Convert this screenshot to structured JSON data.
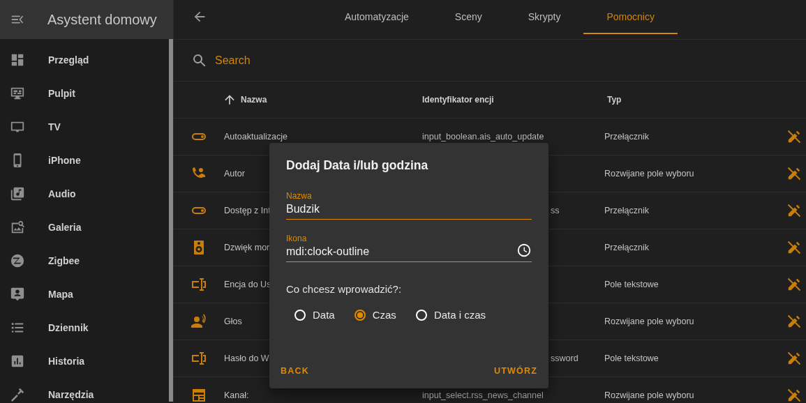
{
  "sidebar": {
    "title": "Asystent domowy",
    "items": [
      {
        "label": "Przegląd"
      },
      {
        "label": "Pulpit"
      },
      {
        "label": "TV"
      },
      {
        "label": "iPhone"
      },
      {
        "label": "Audio"
      },
      {
        "label": "Galeria"
      },
      {
        "label": "Zigbee"
      },
      {
        "label": "Mapa"
      },
      {
        "label": "Dziennik"
      },
      {
        "label": "Historia"
      },
      {
        "label": "Narzędzia"
      }
    ]
  },
  "tabs": [
    {
      "label": "Automatyzacje",
      "selected": false
    },
    {
      "label": "Sceny",
      "selected": false
    },
    {
      "label": "Skrypty",
      "selected": false
    },
    {
      "label": "Pomocnicy",
      "selected": true
    }
  ],
  "search": {
    "placeholder": "Search"
  },
  "table": {
    "columns": [
      "Nazwa",
      "Identyfikator encji",
      "Typ"
    ],
    "rows": [
      {
        "name": "Autoaktualizacje",
        "entity_id": "input_boolean.ais_auto_update",
        "type": "Przełącznik"
      },
      {
        "name": "Autor",
        "type": "Rozwijane pole wyboru"
      },
      {
        "name": "Dostęp z Int",
        "entity_id_tail": "ss",
        "type": "Przełącznik"
      },
      {
        "name": "Dzwięk mor",
        "type": "Przełącznik"
      },
      {
        "name": "Encja do Us",
        "type": "Pole tekstowe"
      },
      {
        "name": "Głos",
        "type": "Rozwijane pole wyboru"
      },
      {
        "name": "Hasło do W",
        "entity_id_tail": "ssword",
        "type": "Pole tekstowe"
      },
      {
        "name": "Kanał:",
        "entity_id": "input_select.rss_news_channel",
        "type": "Rozwijane pole wyboru"
      }
    ]
  },
  "dialog": {
    "title": "Dodaj Data i/lub godzina",
    "fields": [
      {
        "label": "Nazwa",
        "value": "Budzik",
        "kind": "text"
      },
      {
        "label": "Ikona",
        "value": "mdi:clock-outline",
        "kind": "icon"
      }
    ],
    "question": "Co chcesz wprowadzić?:",
    "options": [
      {
        "label": "Data",
        "selected": false
      },
      {
        "label": "Czas",
        "selected": true
      },
      {
        "label": "Data i czas",
        "selected": false
      }
    ],
    "buttons": [
      "BACK",
      "UTWÓRZ"
    ]
  }
}
